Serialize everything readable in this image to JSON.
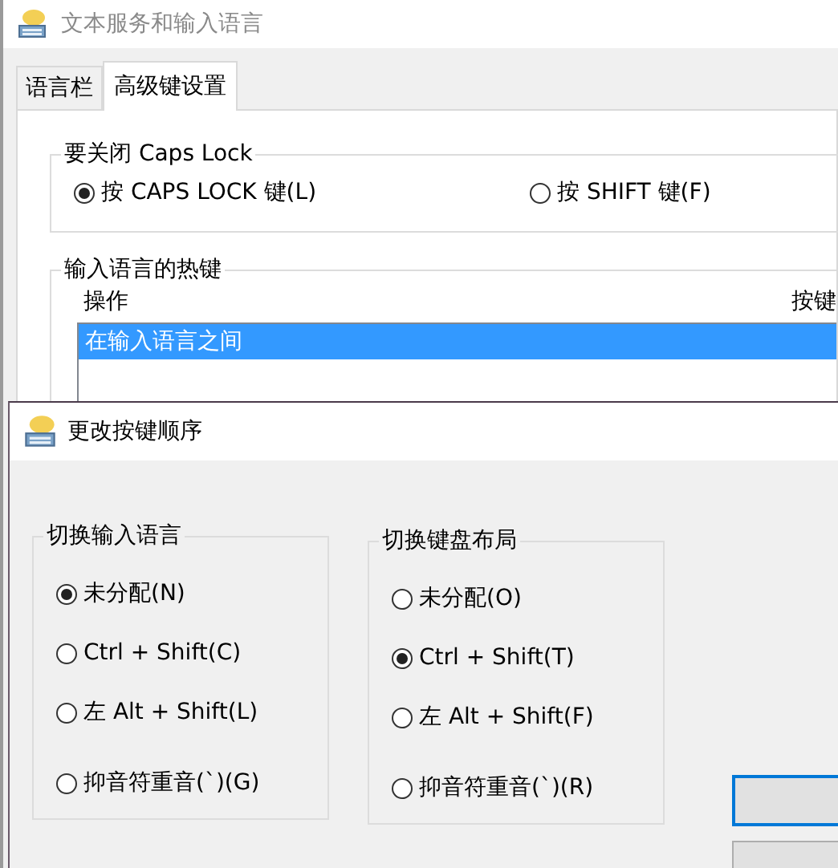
{
  "window": {
    "title": "文本服务和输入语言"
  },
  "tabs": [
    {
      "label": "语言栏",
      "selected": false
    },
    {
      "label": "高级键设置",
      "selected": true
    }
  ],
  "caps_lock_group": {
    "title": "要关闭 Caps Lock",
    "options": [
      {
        "label": "按 CAPS LOCK 键(L)",
        "selected": true
      },
      {
        "label": "按 SHIFT 键(F)",
        "selected": false
      }
    ]
  },
  "hotkeys_group": {
    "title": "输入语言的热键",
    "columns": [
      "操作",
      "按键"
    ],
    "rows": [
      {
        "action": "在输入语言之间",
        "selected": true
      }
    ]
  },
  "dialog": {
    "title": "更改按键顺序",
    "groups": [
      {
        "title": "切换输入语言",
        "options": [
          {
            "label": "未分配(N)",
            "selected": true
          },
          {
            "label": "Ctrl + Shift(C)",
            "selected": false
          },
          {
            "label": "左 Alt + Shift(L)",
            "selected": false
          },
          {
            "label": "抑音符重音(`)(G)",
            "selected": false
          }
        ]
      },
      {
        "title": "切换键盘布局",
        "options": [
          {
            "label": "未分配(O)",
            "selected": false
          },
          {
            "label": "Ctrl + Shift(T)",
            "selected": true
          },
          {
            "label": "左 Alt + Shift(F)",
            "selected": false
          },
          {
            "label": "抑音符重音(`)(R)",
            "selected": false
          }
        ]
      }
    ],
    "buttons": [
      {
        "default": true
      },
      {
        "default": false
      }
    ]
  }
}
